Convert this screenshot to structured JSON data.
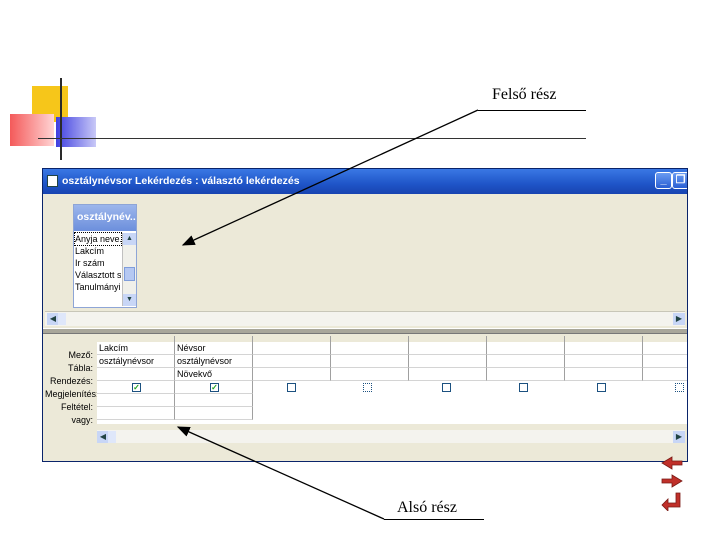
{
  "callouts": {
    "top": "Felső rész",
    "bottom": "Alsó rész"
  },
  "window": {
    "title": "osztálynévsor Lekérdezés : választó lekérdezés",
    "buttons": {
      "minimize": "_",
      "restore": "❐"
    }
  },
  "table_box": {
    "title": "osztálynév...",
    "fields": [
      "Anyja neve..",
      "Lakcím",
      "Ir szám",
      "Választott sza",
      "Tanulmányi át"
    ]
  },
  "grid": {
    "row_labels": [
      "Mező:",
      "Tábla:",
      "Rendezés:",
      "Megjelenítés:",
      "Feltétel:",
      "vagy:"
    ],
    "columns": [
      {
        "field": "Lakcím",
        "table": "osztálynévsor",
        "sort": "",
        "show": true
      },
      {
        "field": "Névsor",
        "table": "osztálynévsor",
        "sort": "Növekvő",
        "show": true
      },
      {
        "field": "",
        "table": "",
        "sort": "",
        "show": false
      },
      {
        "field": "",
        "table": "",
        "sort": "",
        "show": false
      },
      {
        "field": "",
        "table": "",
        "sort": "",
        "show": false
      },
      {
        "field": "",
        "table": "",
        "sort": "",
        "show": false
      },
      {
        "field": "",
        "table": "",
        "sort": "",
        "show": false
      },
      {
        "field": "",
        "table": "",
        "sort": "",
        "show": false
      }
    ]
  },
  "colors": {
    "titlebar": "#1f55c8",
    "window_bg": "#ece9d8",
    "accent_check": "#21a121"
  }
}
